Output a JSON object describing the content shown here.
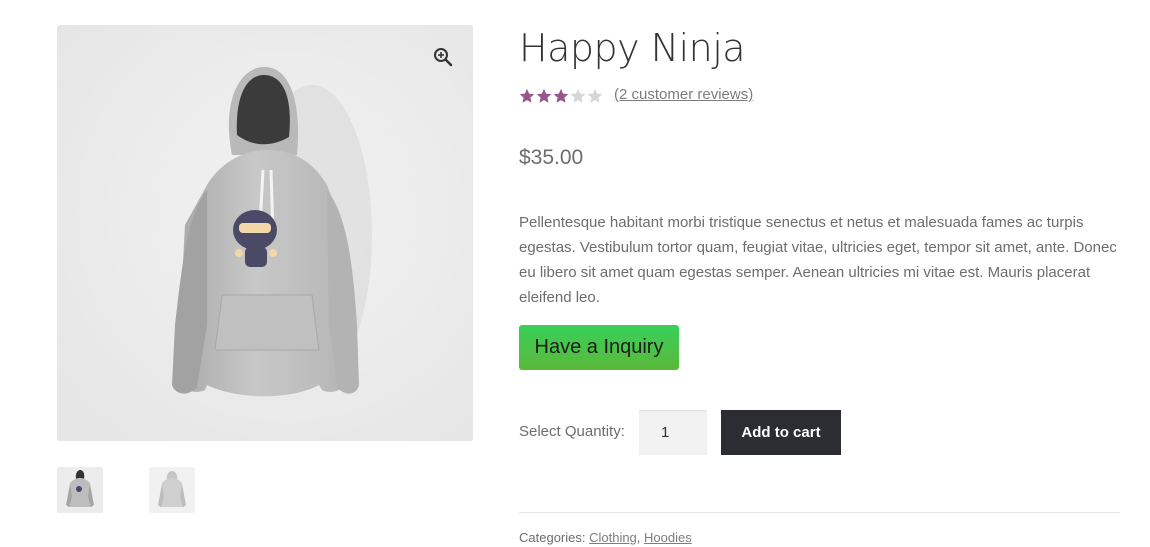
{
  "product": {
    "title": "Happy Ninja",
    "rating": 3,
    "rating_max": 5,
    "star_color": "#96588a",
    "star_empty_color": "#d6d6d6",
    "reviews_link": "(2 customer reviews)",
    "price": "$35.00",
    "description": "Pellentesque habitant morbi tristique senectus et netus et malesuada fames ac turpis egestas. Vestibulum tortor quam, feugiat vitae, ultricies eget, tempor sit amet, ante. Donec eu libero sit amet quam egestas semper. Aenean ultricies mi vitae est. Mauris placerat eleifend leo."
  },
  "gallery": {
    "zoom_icon": "zoom-in-icon",
    "thumbnails": [
      "hoodie-front-thumbnail",
      "hoodie-back-thumbnail"
    ]
  },
  "actions": {
    "inquiry_label": "Have a Inquiry",
    "quantity_label": "Select Quantity:",
    "quantity_value": "1",
    "add_to_cart_label": "Add to cart"
  },
  "meta": {
    "categories_label": "Categories: ",
    "separator": ", ",
    "categories": [
      "Clothing",
      "Hoodies"
    ]
  }
}
